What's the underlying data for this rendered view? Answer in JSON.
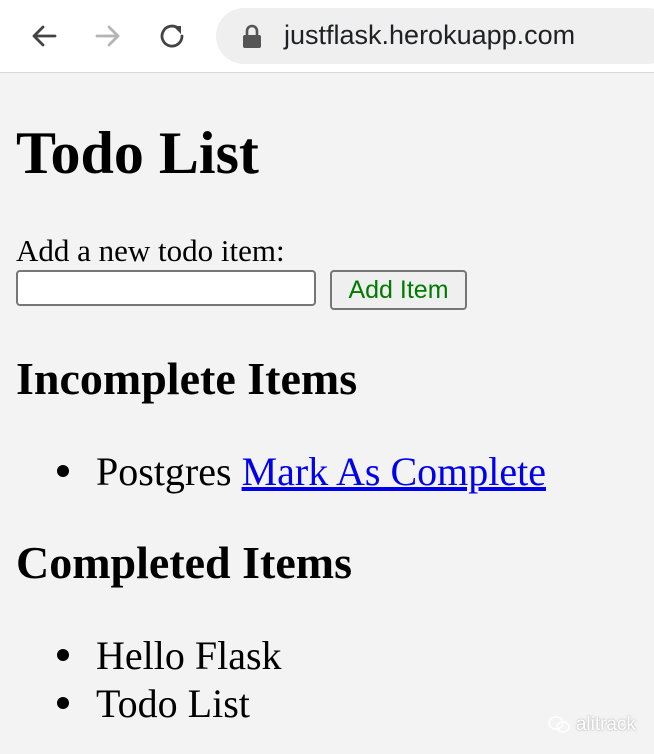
{
  "browser": {
    "url": "justflask.herokuapp.com",
    "icons": [
      "back-arrow-icon",
      "forward-arrow-icon",
      "reload-icon",
      "lock-icon"
    ]
  },
  "page": {
    "title": "Todo List",
    "form": {
      "label": "Add a new todo item:",
      "input_value": "",
      "input_placeholder": "",
      "button_label": "Add Item"
    },
    "incomplete": {
      "heading": "Incomplete Items",
      "items": [
        {
          "text": "Postgres",
          "action_label": "Mark As Complete"
        }
      ]
    },
    "completed": {
      "heading": "Completed Items",
      "items": [
        {
          "text": "Hello Flask"
        },
        {
          "text": "Todo List"
        }
      ]
    }
  },
  "watermark": {
    "text": "alitrack"
  },
  "colors": {
    "page_background": "#f3f3f3",
    "link": "#0000ee",
    "button_text": "#007a00"
  }
}
